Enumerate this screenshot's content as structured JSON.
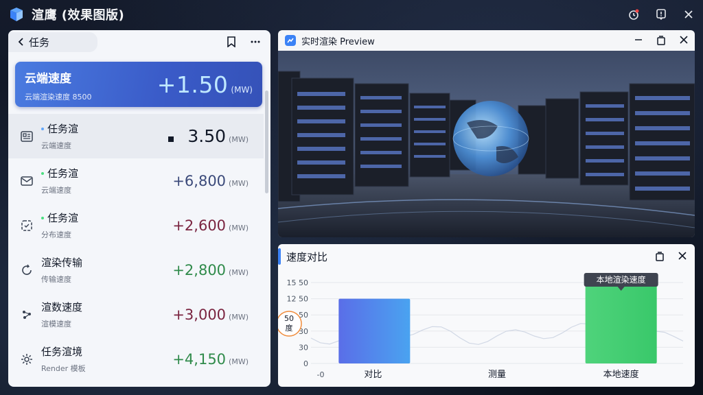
{
  "app": {
    "title": "渲鹰 (效果图版)"
  },
  "left_panel": {
    "back_label": "任务",
    "hero": {
      "title": "云端速度",
      "subtitle": "云端渲染速度 8500",
      "value": "+1.50",
      "unit": "(MW)"
    },
    "rows": [
      {
        "title": "任务渲",
        "subtitle": "云端速度",
        "value": "3.50",
        "unit": "(MW)",
        "color": "#111827",
        "icon": "gallery-icon"
      },
      {
        "title": "任务渲",
        "subtitle": "云端速度",
        "value": "+6,800",
        "unit": "(MW)",
        "color": "#3b4a7a",
        "icon": "mail-icon"
      },
      {
        "title": "任务渲",
        "subtitle": "分布速度",
        "value": "+2,600",
        "unit": "(MW)",
        "color": "#7a2440",
        "icon": "cube-icon"
      },
      {
        "title": "渲染传输",
        "subtitle": "传输速度",
        "value": "+2,800",
        "unit": "(MW)",
        "color": "#2f8a4a",
        "icon": "refresh-icon"
      },
      {
        "title": "渲数速度",
        "subtitle": "渲模速度",
        "value": "+3,000",
        "unit": "(MW)",
        "color": "#7a2440",
        "icon": "shuffle-icon"
      },
      {
        "title": "任务渲境",
        "subtitle": "Render 模板",
        "value": "+4,150",
        "unit": "(MW)",
        "color": "#2f8a4a",
        "icon": "gear-icon"
      }
    ]
  },
  "preview": {
    "title": "实时渲染 Preview"
  },
  "chart_panel": {
    "title": "速度对比"
  },
  "chart_data": {
    "type": "bar",
    "categories": [
      "对比",
      "测量",
      "本地速度"
    ],
    "values": [
      80,
      null,
      100
    ],
    "y_ticks": [
      "0",
      "30",
      "30",
      "50",
      "12 50",
      "15 50"
    ],
    "y_badge": "50\n度",
    "x_start": "-0",
    "annotation": "本地渲染速度",
    "colors": [
      "#4f74e8",
      null,
      "#3ecf72"
    ]
  }
}
